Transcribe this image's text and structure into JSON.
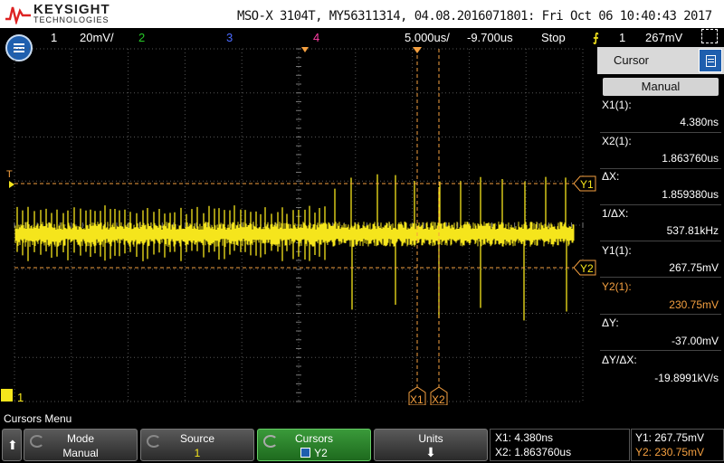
{
  "brand": {
    "name": "KEYSIGHT",
    "sub": "TECHNOLOGIES"
  },
  "instrument_info": "MSO-X 3104T, MY56311314, 04.08.2016071801: Fri Oct 06 10:40:43 2017",
  "status": {
    "ch1_num": "1",
    "ch1_scale": "20mV/",
    "ch2_num": "2",
    "ch3_num": "3",
    "ch4_num": "4",
    "timebase": "5.000us/",
    "delay": "-9.700us",
    "run_state": "Stop",
    "trig_ch": "1",
    "trig_level": "267mV"
  },
  "markers": {
    "trigger_level": "T",
    "ch1_ground": "1",
    "x1": "X1",
    "x2": "X2",
    "y1": "Y1",
    "y2": "Y2"
  },
  "panel": {
    "title": "Cursor",
    "mode": "Manual",
    "x1_label": "X1(1):",
    "x1_value": "4.380ns",
    "x2_label": "X2(1):",
    "x2_value": "1.863760us",
    "dx_label": "ΔX:",
    "dx_value": "1.859380us",
    "inv_dx_label": "1/ΔX:",
    "inv_dx_value": "537.81kHz",
    "y1_label": "Y1(1):",
    "y1_value": "267.75mV",
    "y2_label": "Y2(1):",
    "y2_value": "230.75mV",
    "dy_label": "ΔY:",
    "dy_value": "-37.00mV",
    "dydx_label": "ΔY/ΔX:",
    "dydx_value": "-19.8991kV/s"
  },
  "bottom": {
    "menu_title": "Cursors Menu",
    "mode_label": "Mode",
    "mode_value": "Manual",
    "source_label": "Source",
    "source_value": "1",
    "cursors_label": "Cursors",
    "cursors_value": "Y2",
    "units_label": "Units",
    "readout_x1": "X1: 4.380ns",
    "readout_x2": "X2: 1.863760us",
    "readout_y1": "Y1: 267.75mV",
    "readout_y2": "Y2: 230.75mV"
  },
  "colors": {
    "ch1": "#f5e51c",
    "ch2": "#27c827",
    "ch3": "#4b6bff",
    "ch4": "#ff3ea5",
    "cursor": "#f5a040"
  },
  "icons": {
    "menu": "menu-icon",
    "trigger": "trigger-edge-icon",
    "up_arrow": "up-arrow-icon",
    "down_arrow": "down-arrow-icon"
  }
}
